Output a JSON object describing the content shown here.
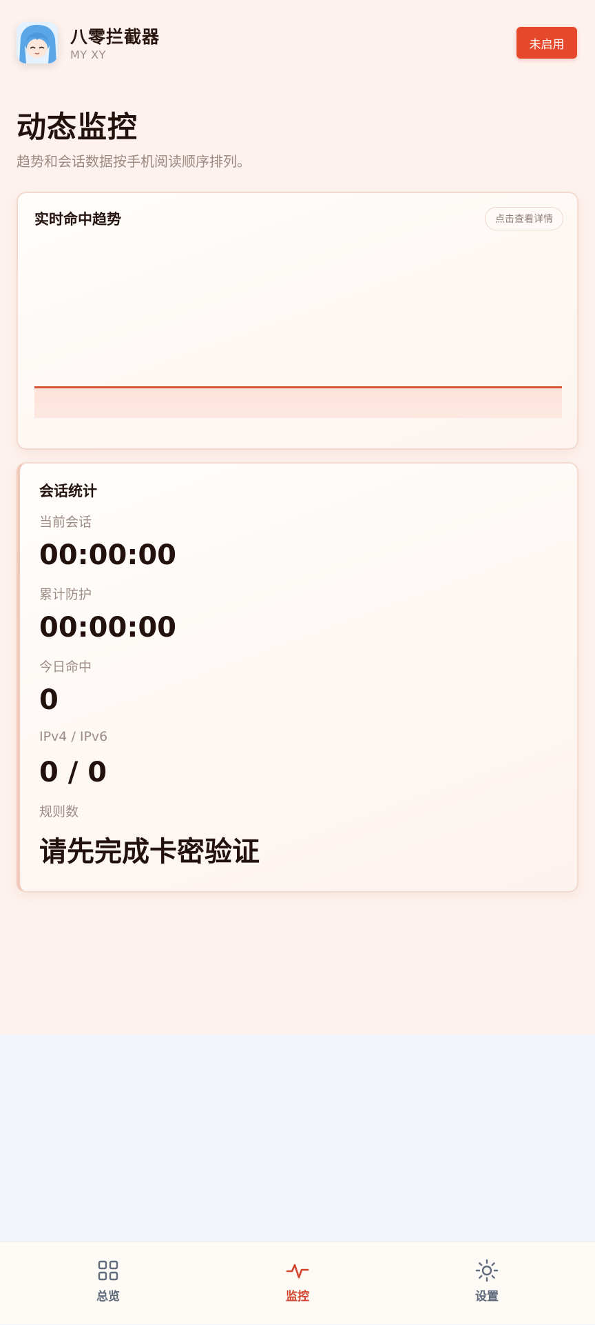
{
  "header": {
    "title": "八零拦截器",
    "subtitle": "MY XY",
    "status_button": "未启用"
  },
  "page": {
    "title": "动态监控",
    "description": "趋势和会话数据按手机阅读顺序排列。"
  },
  "trend_card": {
    "title": "实时命中趋势",
    "detail_button": "点击查看详情"
  },
  "session_card": {
    "title": "会话统计",
    "stats": [
      {
        "label": "当前会话",
        "value": "00:00:00"
      },
      {
        "label": "累计防护",
        "value": "00:00:00"
      },
      {
        "label": "今日命中",
        "value": "0"
      },
      {
        "label": "IPv4 / IPv6",
        "value": "0 / 0"
      },
      {
        "label": "规则数",
        "value": "请先完成卡密验证"
      }
    ]
  },
  "nav": {
    "items": [
      {
        "label": "总览",
        "icon": "grid-icon",
        "active": false
      },
      {
        "label": "监控",
        "icon": "pulse-icon",
        "active": true
      },
      {
        "label": "设置",
        "icon": "sun-gear-icon",
        "active": false
      }
    ]
  },
  "colors": {
    "accent": "#e5492b",
    "nav_active": "#d2452d",
    "nav_inactive": "#5f6b7c"
  }
}
